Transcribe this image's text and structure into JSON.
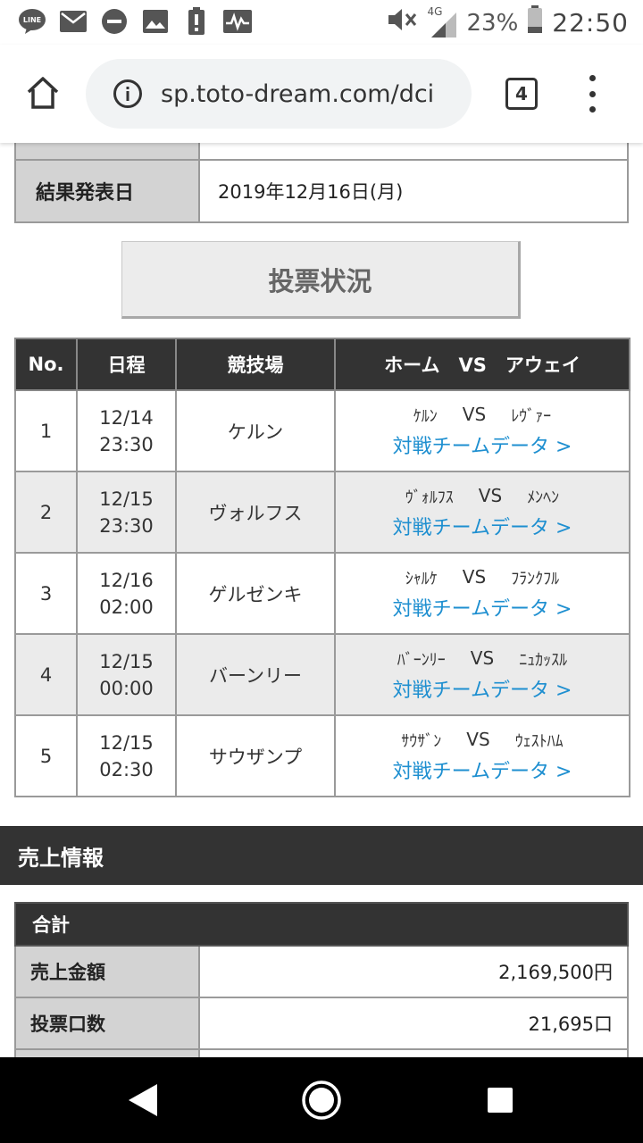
{
  "status_bar": {
    "notification_icons": [
      "line-icon",
      "mail-icon",
      "minus-circle-icon",
      "image-icon",
      "alert-icon",
      "pulse-icon"
    ],
    "line_label": "LINE",
    "network": "4G",
    "battery": "23%",
    "time": "22:50"
  },
  "browser": {
    "url": "sp.toto-dream.com/dci",
    "tab_count": "4"
  },
  "info": {
    "result_label": "結果発表日",
    "result_value": "2019年12月16日(月)"
  },
  "vote_button": "投票状況",
  "matches": {
    "headers": [
      "No.",
      "日程",
      "競技場",
      "ホーム　VS　アウェイ"
    ],
    "rows": [
      {
        "no": "1",
        "date": "12/14",
        "time": "23:30",
        "venue": "ケルン",
        "home": "ｹﾙﾝ",
        "vs": "VS",
        "away": "ﾚｳﾞｧｰ",
        "link": "対戦チームデータ >"
      },
      {
        "no": "2",
        "date": "12/15",
        "time": "23:30",
        "venue": "ヴォルフス",
        "home": "ｳﾞｫﾙﾌｽ",
        "vs": "VS",
        "away": "ﾒﾝﾍﾝ",
        "link": "対戦チームデータ >"
      },
      {
        "no": "3",
        "date": "12/16",
        "time": "02:00",
        "venue": "ゲルゼンキ",
        "home": "ｼｬﾙｹ",
        "vs": "VS",
        "away": "ﾌﾗﾝｸﾌﾙ",
        "link": "対戦チームデータ >"
      },
      {
        "no": "4",
        "date": "12/15",
        "time": "00:00",
        "venue": "バーンリー",
        "home": "ﾊﾞｰﾝﾘｰ",
        "vs": "VS",
        "away": "ﾆｭｶｯｽﾙ",
        "link": "対戦チームデータ >"
      },
      {
        "no": "5",
        "date": "12/15",
        "time": "02:30",
        "venue": "サウザンプ",
        "home": "ｻｳｻﾞﾝ",
        "vs": "VS",
        "away": "ｳｪｽﾄﾊﾑ",
        "link": "対戦チームデータ >"
      }
    ]
  },
  "sales": {
    "title": "売上情報",
    "total_label": "合計",
    "rows": [
      {
        "label": "売上金額",
        "value": "2,169,500円"
      },
      {
        "label": "投票口数",
        "value": "21,695口"
      }
    ]
  },
  "colors": {
    "header_bg": "#333333",
    "label_bg": "#d3d3d3",
    "link": "#1e8fd0",
    "alt_row": "#ebebeb"
  }
}
